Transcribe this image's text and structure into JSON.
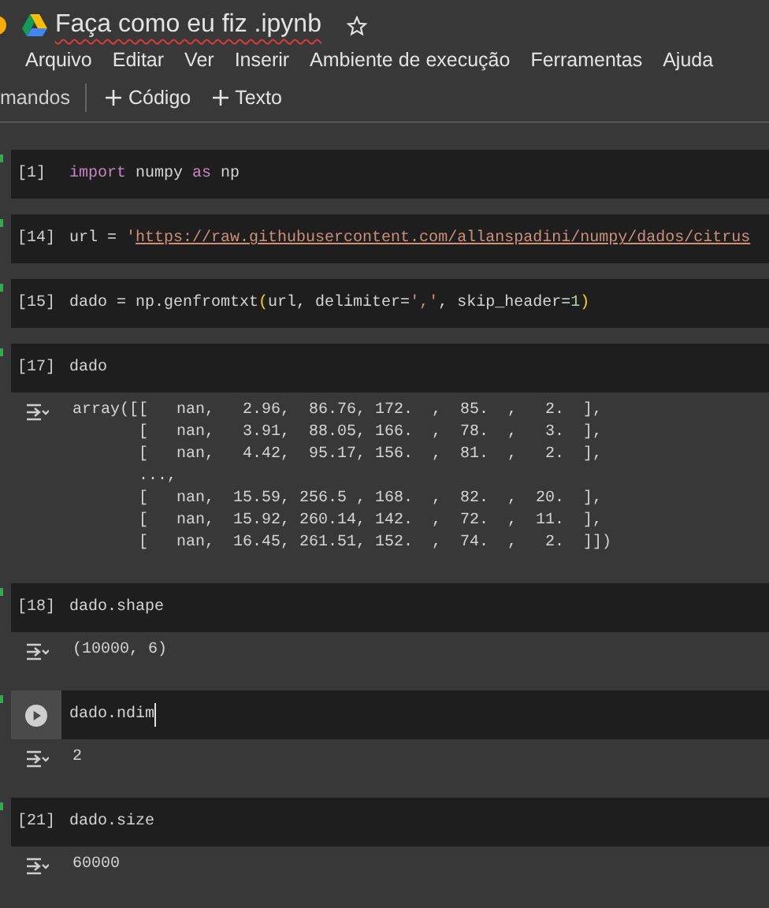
{
  "title": "Faça como eu fiz .ipynb",
  "menu": [
    "Arquivo",
    "Editar",
    "Ver",
    "Inserir",
    "Ambiente de execução",
    "Ferramentas",
    "Ajuda"
  ],
  "toolbar": {
    "cut_label": "mandos",
    "buttons": [
      "Código",
      "Texto"
    ]
  },
  "cells": [
    {
      "count": "[1]",
      "focused": false,
      "code": [
        {
          "text": "import",
          "kind": "keyword"
        },
        {
          "text": " numpy ",
          "kind": "plain"
        },
        {
          "text": "as",
          "kind": "keyword"
        },
        {
          "text": " np",
          "kind": "plain"
        }
      ]
    },
    {
      "count": "[14]",
      "focused": false,
      "code": [
        {
          "text": "url = ",
          "kind": "plain"
        },
        {
          "text": "'",
          "kind": "string"
        },
        {
          "text": "https://raw.githubusercontent.com/allanspadini/numpy/dados/citrus",
          "kind": "link"
        }
      ]
    },
    {
      "count": "[15]",
      "focused": false,
      "code": [
        {
          "text": "dado = np.genfromtxt",
          "kind": "plain"
        },
        {
          "text": "(",
          "kind": "paren"
        },
        {
          "text": "url, delimiter=",
          "kind": "plain"
        },
        {
          "text": "','",
          "kind": "string"
        },
        {
          "text": ", skip_header=",
          "kind": "plain"
        },
        {
          "text": "1",
          "kind": "number"
        },
        {
          "text": ")",
          "kind": "paren"
        }
      ]
    },
    {
      "count": "[17]",
      "focused": false,
      "code": [
        {
          "text": "dado",
          "kind": "plain"
        }
      ],
      "output": "array([[   nan,   2.96,  86.76, 172.  ,  85.  ,   2.  ],\n       [   nan,   3.91,  88.05, 166.  ,  78.  ,   3.  ],\n       [   nan,   4.42,  95.17, 156.  ,  81.  ,   2.  ],\n       ...,\n       [   nan,  15.59, 256.5 , 168.  ,  82.  ,  20.  ],\n       [   nan,  15.92, 260.14, 142.  ,  72.  ,  11.  ],\n       [   nan,  16.45, 261.51, 152.  ,  74.  ,   2.  ]])"
    },
    {
      "count": "[18]",
      "focused": false,
      "code": [
        {
          "text": "dado.shape",
          "kind": "plain"
        }
      ],
      "output": "(10000, 6)"
    },
    {
      "focused": true,
      "code": [
        {
          "text": "dado.ndim",
          "kind": "plain"
        }
      ],
      "output": "2"
    },
    {
      "count": "[21]",
      "focused": false,
      "code": [
        {
          "text": "dado.size",
          "kind": "plain"
        }
      ],
      "output": "60000"
    }
  ]
}
